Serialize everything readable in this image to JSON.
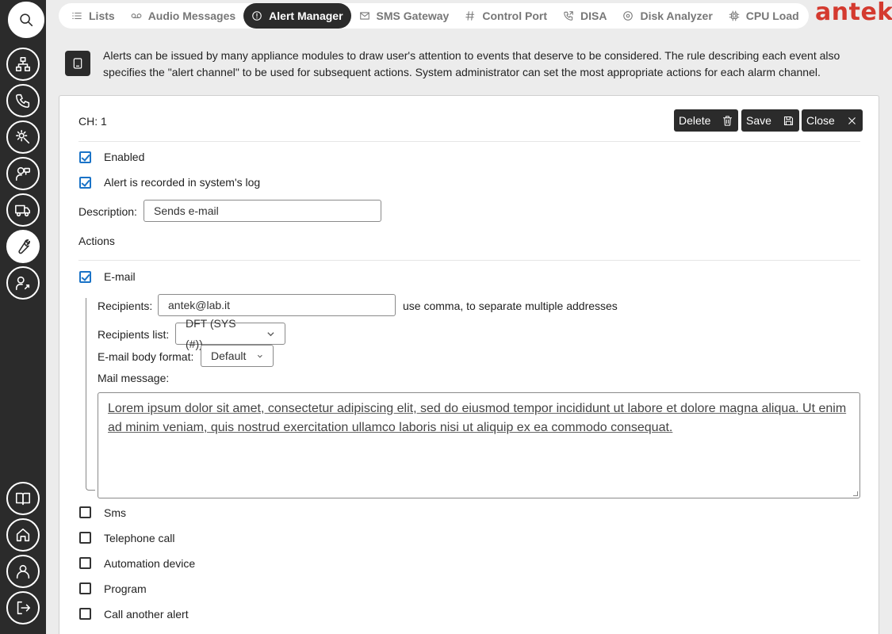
{
  "sidebar": {
    "icons": [
      "search-icon",
      "network-icon",
      "phone-icon",
      "gear-tools-icon",
      "user-support-icon",
      "truck-icon",
      "wrench-icon",
      "user-settings-icon",
      "book-icon",
      "home-icon",
      "user-icon",
      "logout-icon"
    ],
    "active": "wrench-icon"
  },
  "tabs": [
    {
      "label": "Lists",
      "icon": "list-icon"
    },
    {
      "label": "Audio Messages",
      "icon": "voicemail-icon"
    },
    {
      "label": "Alert Manager",
      "icon": "alert-icon",
      "active": true
    },
    {
      "label": "SMS Gateway",
      "icon": "mail-icon"
    },
    {
      "label": "Control Port",
      "icon": "hash-icon"
    },
    {
      "label": "DISA",
      "icon": "phone-forward-icon"
    },
    {
      "label": "Disk Analyzer",
      "icon": "disk-icon"
    },
    {
      "label": "CPU Load",
      "icon": "cpu-icon"
    }
  ],
  "brand": {
    "logo": "antek",
    "color": "#d43a2f"
  },
  "info": {
    "text": "Alerts can be issued by many appliance modules to draw user's attention to events that deserve to be considered. The rule describing each event also specifies the \"alert channel\" to be used for subsequent actions. System administrator can set the most appropriate actions for each alarm channel."
  },
  "panel": {
    "title": "CH: 1",
    "buttons": {
      "delete": "Delete",
      "save": "Save",
      "close": "Close"
    },
    "enabled_label": "Enabled",
    "enabled": true,
    "log_label": "Alert is recorded in system's log",
    "log": true,
    "description_label": "Description:",
    "description_value": "Sends e-mail",
    "actions_heading": "Actions",
    "email": {
      "label": "E-mail",
      "checked": true,
      "recipients_label": "Recipients:",
      "recipients_value": "antek@lab.it",
      "recipients_hint": "use comma, to separate multiple addresses",
      "list_label": "Recipients list:",
      "list_value": "DFT (SYS (#))",
      "format_label": "E-mail body format:",
      "format_value": "Default",
      "message_label": "Mail message:",
      "message_value": "Lorem ipsum dolor sit amet, consectetur adipiscing elit, sed do eiusmod tempor incididunt ut labore et dolore magna aliqua. Ut enim ad minim veniam, quis nostrud exercitation ullamco laboris nisi ut aliquip ex ea commodo consequat."
    },
    "other_actions": [
      {
        "label": "Sms",
        "checked": false
      },
      {
        "label": "Telephone call",
        "checked": false
      },
      {
        "label": "Automation device",
        "checked": false
      },
      {
        "label": "Program",
        "checked": false
      },
      {
        "label": "Call another alert",
        "checked": false
      }
    ]
  }
}
